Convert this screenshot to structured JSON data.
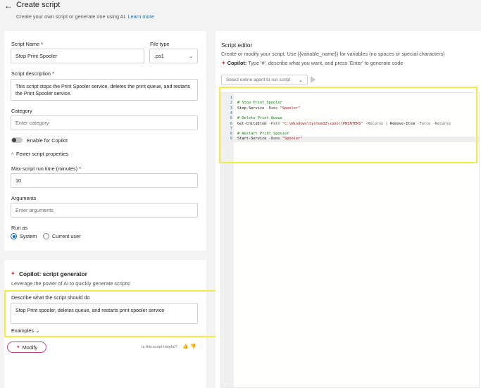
{
  "header": {
    "back_icon": "arrow-left-icon",
    "title": "Create script",
    "subtitle": "Create your own script or generate one using AI.",
    "learn_more": "Learn more"
  },
  "form": {
    "script_name_label": "Script Name *",
    "script_name_value": "Stop Print Spooler",
    "file_type_label": "File type",
    "file_type_value": ".ps1",
    "description_label": "Script description *",
    "description_value": "This script stops the Print Spooler service, deletes the print queue, and restarts the Print Spooler service.",
    "category_label": "Category",
    "category_placeholder": "Enter category",
    "copilot_toggle_label": "Enable for Copilot",
    "fewer_props_label": "Fewer script properties",
    "max_runtime_label": "Max script run time (minutes) *",
    "max_runtime_value": "10",
    "arguments_label": "Arguments",
    "arguments_placeholder": "Enter arguments",
    "run_as_label": "Run as",
    "run_as_options": [
      "System",
      "Current user"
    ],
    "run_as_selected": "System"
  },
  "generator": {
    "title": "Copilot: script generator",
    "subtitle": "Leverage the power of AI to quickly generate scripts!",
    "prompt_label": "Describe what the script should do",
    "prompt_value": "Stop Print spooler, deletes queue, and restarts print spooler service",
    "examples_label": "Examples",
    "modify_label": "Modify",
    "helpful_text": "Is this script helpful?"
  },
  "editor": {
    "title": "Script editor",
    "subtitle": "Create or modify your script. Use {{variable_name}} for variables (no spaces or special characters)",
    "copilot_hint_prefix": "Copilot:",
    "copilot_hint": "Type '#', describe what you want, and press 'Enter' to generate code",
    "agent_placeholder": "Select online agent to run script",
    "line_numbers": [
      "1",
      "2",
      "3",
      "4",
      "5",
      "6",
      "7",
      "8",
      "9"
    ],
    "lines": [
      "",
      "# Stop Print Spooler",
      "Stop-Service -Name \"Spooler\"",
      "",
      "# Delete Print Queue",
      "Get-ChildItem -Path \"C:\\Windows\\System32\\spool\\PRINTERS\" -Recurse | Remove-Item -Force -Recurse",
      "",
      "# Restart Print Spooler",
      "Start-Service -Name \"Spooler\""
    ],
    "active_line": 9
  },
  "colors": {
    "accent": "#0f6cbd",
    "highlight": "#f5e94a",
    "copilot": "#c23c88"
  }
}
